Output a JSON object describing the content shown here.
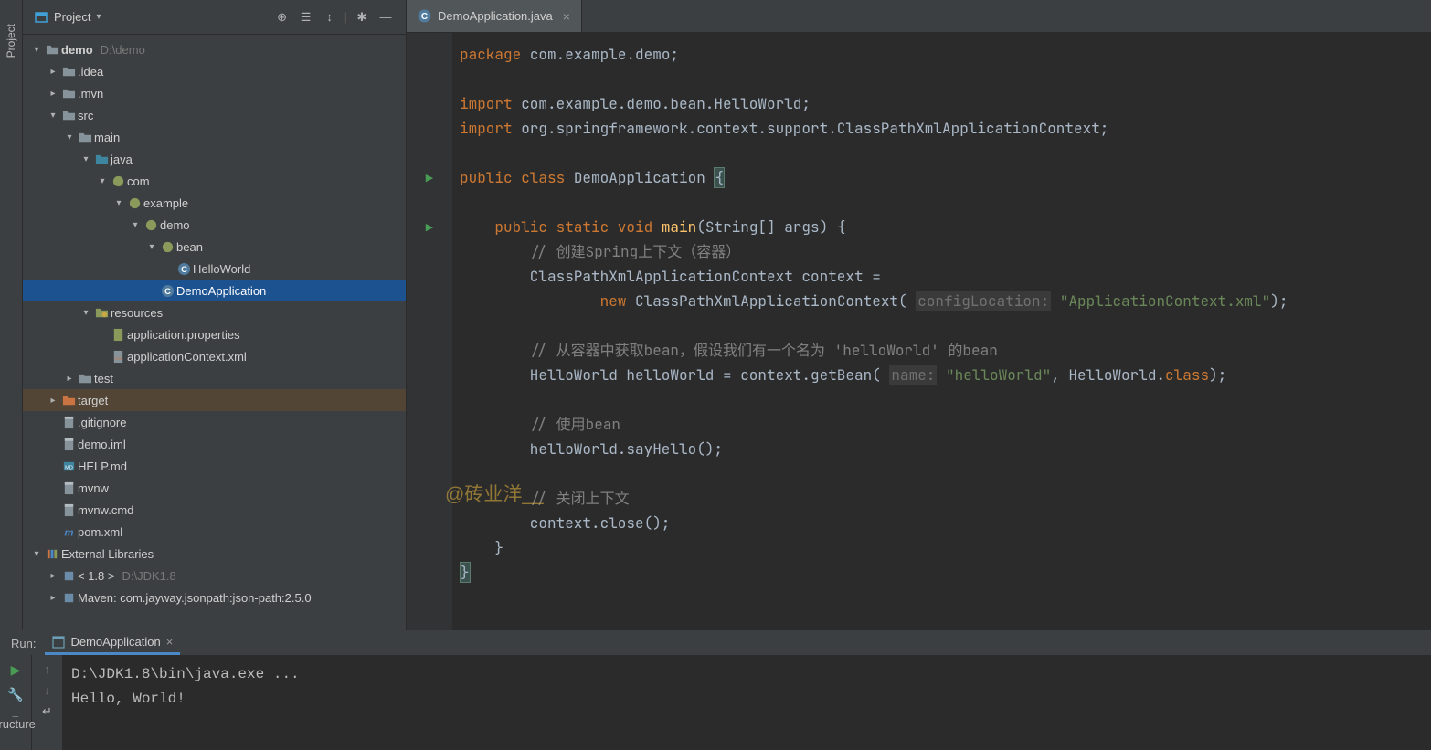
{
  "sidebar": {
    "project_label": "Project",
    "structure_label": "Structure"
  },
  "project_header": {
    "title": "Project",
    "icons": [
      "target-icon",
      "hide-icon",
      "collapse-icon",
      "settings-icon",
      "minimize-icon"
    ]
  },
  "tree": [
    {
      "depth": 0,
      "arrow": "v",
      "icon": "folder",
      "label": "demo",
      "path": "D:\\demo",
      "bold": true
    },
    {
      "depth": 1,
      "arrow": "r",
      "icon": "folder",
      "label": ".idea"
    },
    {
      "depth": 1,
      "arrow": "r",
      "icon": "folder",
      "label": ".mvn"
    },
    {
      "depth": 1,
      "arrow": "v",
      "icon": "folder",
      "label": "src"
    },
    {
      "depth": 2,
      "arrow": "v",
      "icon": "folder",
      "label": "main"
    },
    {
      "depth": 3,
      "arrow": "v",
      "icon": "folder-src",
      "label": "java"
    },
    {
      "depth": 4,
      "arrow": "v",
      "icon": "package",
      "label": "com"
    },
    {
      "depth": 5,
      "arrow": "v",
      "icon": "package",
      "label": "example"
    },
    {
      "depth": 6,
      "arrow": "v",
      "icon": "package",
      "label": "demo"
    },
    {
      "depth": 7,
      "arrow": "v",
      "icon": "package",
      "label": "bean"
    },
    {
      "depth": 8,
      "arrow": "n",
      "icon": "class",
      "label": "HelloWorld"
    },
    {
      "depth": 7,
      "arrow": "n",
      "icon": "class",
      "label": "DemoApplication",
      "selected": true
    },
    {
      "depth": 3,
      "arrow": "v",
      "icon": "folder-res",
      "label": "resources"
    },
    {
      "depth": 4,
      "arrow": "n",
      "icon": "props",
      "label": "application.properties"
    },
    {
      "depth": 4,
      "arrow": "n",
      "icon": "xml",
      "label": "applicationContext.xml"
    },
    {
      "depth": 2,
      "arrow": "r",
      "icon": "folder",
      "label": "test"
    },
    {
      "depth": 1,
      "arrow": "r",
      "icon": "folder-target",
      "label": "target",
      "highlight": true
    },
    {
      "depth": 1,
      "arrow": "n",
      "icon": "file",
      "label": ".gitignore"
    },
    {
      "depth": 1,
      "arrow": "n",
      "icon": "file",
      "label": "demo.iml"
    },
    {
      "depth": 1,
      "arrow": "n",
      "icon": "md",
      "label": "HELP.md"
    },
    {
      "depth": 1,
      "arrow": "n",
      "icon": "file",
      "label": "mvnw"
    },
    {
      "depth": 1,
      "arrow": "n",
      "icon": "file",
      "label": "mvnw.cmd"
    },
    {
      "depth": 1,
      "arrow": "n",
      "icon": "maven",
      "label": "pom.xml"
    },
    {
      "depth": 0,
      "arrow": "v",
      "icon": "lib",
      "label": "External Libraries"
    },
    {
      "depth": 1,
      "arrow": "r",
      "icon": "lib-item",
      "label": "< 1.8 >",
      "path": "D:\\JDK1.8"
    },
    {
      "depth": 1,
      "arrow": "r",
      "icon": "lib-item",
      "label": "Maven: com.jayway.jsonpath:json-path:2.5.0"
    }
  ],
  "editor": {
    "tab_name": "DemoApplication.java",
    "watermark": "@砖业洋__",
    "lines": [
      [
        [
          "kw",
          "package "
        ],
        [
          "txt",
          "com.example.demo;"
        ]
      ],
      [],
      [
        [
          "kw",
          "import "
        ],
        [
          "txt",
          "com.example.demo.bean.HelloWorld;"
        ]
      ],
      [
        [
          "kw",
          "import "
        ],
        [
          "txt",
          "org.springframework.context.support.ClassPathXmlApplicationContext;"
        ]
      ],
      [],
      [
        [
          "kw",
          "public class "
        ],
        [
          "cls",
          "DemoApplication "
        ],
        [
          "hl",
          "{"
        ]
      ],
      [],
      [
        [
          "txt",
          "    "
        ],
        [
          "kw",
          "public static void "
        ],
        [
          "fn",
          "main"
        ],
        [
          "txt",
          "(String[] args) {"
        ]
      ],
      [
        [
          "txt",
          "        "
        ],
        [
          "com",
          "// 创建Spring上下文（容器）"
        ]
      ],
      [
        [
          "txt",
          "        ClassPathXmlApplicationContext context ="
        ]
      ],
      [
        [
          "txt",
          "                "
        ],
        [
          "kw",
          "new "
        ],
        [
          "txt",
          "ClassPathXmlApplicationContext( "
        ],
        [
          "ann",
          "configLocation:"
        ],
        [
          "txt",
          " "
        ],
        [
          "str",
          "\"ApplicationContext.xml\""
        ],
        [
          "txt",
          ");"
        ]
      ],
      [],
      [
        [
          "txt",
          "        "
        ],
        [
          "com",
          "// 从容器中获取bean，假设我们有一个名为 'helloWorld' 的bean"
        ]
      ],
      [
        [
          "txt",
          "        HelloWorld helloWorld = context.getBean( "
        ],
        [
          "ann",
          "name:"
        ],
        [
          "txt",
          " "
        ],
        [
          "str",
          "\"helloWorld\""
        ],
        [
          "txt",
          ", HelloWorld."
        ],
        [
          "kw",
          "class"
        ],
        [
          "txt",
          ");"
        ]
      ],
      [],
      [
        [
          "txt",
          "        "
        ],
        [
          "com",
          "// 使用bean"
        ]
      ],
      [
        [
          "txt",
          "        helloWorld.sayHello();"
        ]
      ],
      [],
      [
        [
          "txt",
          "        "
        ],
        [
          "com",
          "// 关闭上下文"
        ]
      ],
      [
        [
          "txt",
          "        context.close();"
        ]
      ],
      [
        [
          "txt",
          "    }"
        ]
      ],
      [
        [
          "hl",
          "}"
        ]
      ]
    ],
    "gutter_marks": {
      "5": "run",
      "7": "run"
    }
  },
  "run": {
    "label": "Run:",
    "config_name": "DemoApplication",
    "console_lines": [
      "D:\\JDK1.8\\bin\\java.exe ...",
      "Hello, World!"
    ]
  }
}
